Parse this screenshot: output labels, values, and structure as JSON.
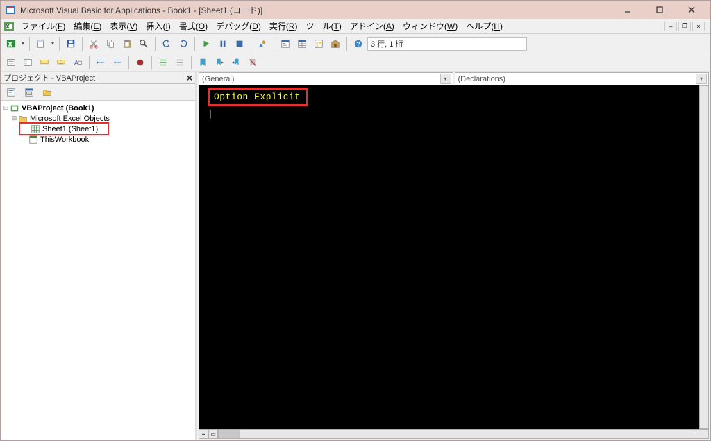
{
  "titlebar": {
    "title": "Microsoft Visual Basic for Applications - Book1 - [Sheet1 (コード)]"
  },
  "menu": {
    "items": [
      {
        "label": "ファイル",
        "accel": "F"
      },
      {
        "label": "編集",
        "accel": "E"
      },
      {
        "label": "表示",
        "accel": "V"
      },
      {
        "label": "挿入",
        "accel": "I"
      },
      {
        "label": "書式",
        "accel": "O"
      },
      {
        "label": "デバッグ",
        "accel": "D"
      },
      {
        "label": "実行",
        "accel": "R"
      },
      {
        "label": "ツール",
        "accel": "T"
      },
      {
        "label": "アドイン",
        "accel": "A"
      },
      {
        "label": "ウィンドウ",
        "accel": "W"
      },
      {
        "label": "ヘルプ",
        "accel": "H"
      }
    ]
  },
  "position_display": "3 行, 1 桁",
  "project_pane": {
    "title": "プロジェクト - VBAProject",
    "tree": {
      "root": "VBAProject (Book1)",
      "folder": "Microsoft Excel Objects",
      "sheet": "Sheet1 (Sheet1)",
      "workbook": "ThisWorkbook"
    }
  },
  "code_dropdowns": {
    "object": "(General)",
    "proc": "(Declarations)"
  },
  "code": {
    "line1": "Option Explicit"
  }
}
